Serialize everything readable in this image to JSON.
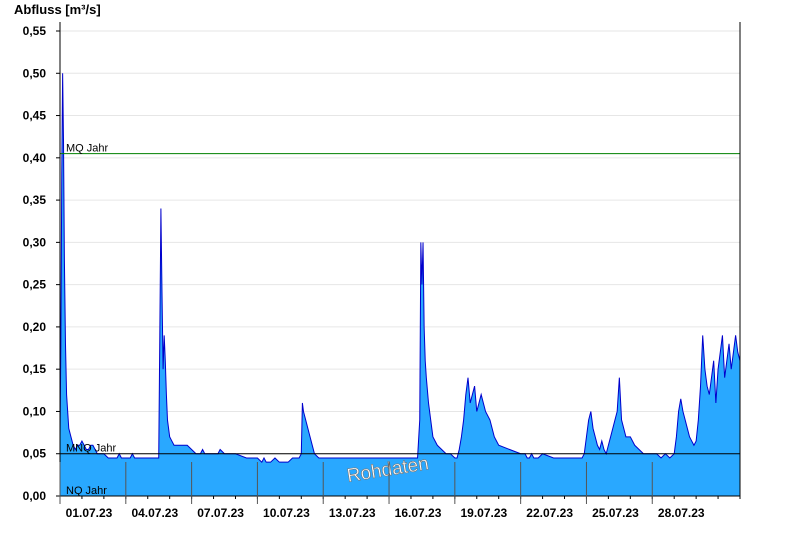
{
  "chart_data": {
    "type": "area",
    "title": "",
    "ylabel": "Abfluss [m³/s]",
    "xlabel": "",
    "xlim": [
      1,
      32
    ],
    "ylim": [
      0,
      0.56
    ],
    "yticks": [
      0,
      0.05,
      0.1,
      0.15,
      0.2,
      0.25,
      0.3,
      0.35,
      0.4,
      0.45,
      0.5,
      0.55
    ],
    "ytick_labels": [
      "0,00",
      "0,05",
      "0,10",
      "0,15",
      "0,20",
      "0,25",
      "0,30",
      "0,35",
      "0,40",
      "0,45",
      "0,50",
      "0,55"
    ],
    "xticks": [
      1,
      4,
      7,
      10,
      13,
      16,
      19,
      22,
      25,
      28
    ],
    "xtick_labels": [
      "01.07.23",
      "04.07.23",
      "07.07.23",
      "10.07.23",
      "13.07.23",
      "16.07.23",
      "19.07.23",
      "22.07.23",
      "25.07.23",
      "28.07.23"
    ],
    "grid": true,
    "colors": {
      "fill": "#29a8ff",
      "line": "#0000cc",
      "mq": "#008000",
      "ref": "#000000",
      "grid": "#e6e6e6"
    },
    "reference_lines": [
      {
        "label": "MQ Jahr",
        "value": 0.405
      },
      {
        "label": "MNQ Jahr",
        "value": 0.05
      },
      {
        "label": "NQ Jahr",
        "value": 0.0
      }
    ],
    "watermark": "Rohdaten",
    "series": [
      {
        "x": [
          1.0,
          1.04,
          1.08,
          1.12,
          1.16,
          1.2,
          1.25,
          1.3,
          1.35,
          1.4,
          1.5,
          1.6,
          1.7,
          1.8,
          1.9,
          2.0,
          2.1,
          2.2,
          2.3,
          2.4,
          2.5,
          2.6,
          2.7,
          2.8,
          2.9,
          3.0,
          3.2,
          3.4,
          3.6,
          3.7,
          3.8,
          4.0,
          4.2,
          4.3,
          4.4,
          4.5,
          4.6,
          4.7,
          4.8,
          5.0,
          5.2,
          5.5,
          5.55,
          5.6,
          5.65,
          5.7,
          5.75,
          5.8,
          5.85,
          5.9,
          6.0,
          6.1,
          6.2,
          6.3,
          6.5,
          6.8,
          7.0,
          7.2,
          7.4,
          7.5,
          7.6,
          7.8,
          8.0,
          8.2,
          8.3,
          8.5,
          8.8,
          9.0,
          9.5,
          10.0,
          10.2,
          10.3,
          10.4,
          10.6,
          10.8,
          11.0,
          11.2,
          11.4,
          11.6,
          11.9,
          12.0,
          12.05,
          12.1,
          12.2,
          12.3,
          12.4,
          12.5,
          12.6,
          12.8,
          13.0,
          13.5,
          14.0,
          14.5,
          15.0,
          15.5,
          16.0,
          16.5,
          17.0,
          17.3,
          17.4,
          17.45,
          17.5,
          17.55,
          17.6,
          17.65,
          17.7,
          17.8,
          17.9,
          18.0,
          18.2,
          18.4,
          18.6,
          18.8,
          19.0,
          19.1,
          19.2,
          19.3,
          19.4,
          19.5,
          19.6,
          19.7,
          19.8,
          19.9,
          20.0,
          20.1,
          20.2,
          20.3,
          20.4,
          20.6,
          20.8,
          21.0,
          21.5,
          22.0,
          22.2,
          22.3,
          22.4,
          22.5,
          22.6,
          22.8,
          23.0,
          23.5,
          24.0,
          24.4,
          24.6,
          24.7,
          24.8,
          24.9,
          25.0,
          25.1,
          25.2,
          25.3,
          25.4,
          25.5,
          25.6,
          25.7,
          25.8,
          25.9,
          26.0,
          26.1,
          26.2,
          26.3,
          26.4,
          26.5,
          26.6,
          26.7,
          26.8,
          27.0,
          27.2,
          27.4,
          27.6,
          27.8,
          28.0,
          28.2,
          28.4,
          28.6,
          28.8,
          29.0,
          29.1,
          29.2,
          29.3,
          29.4,
          29.5,
          29.6,
          29.7,
          29.8,
          29.9,
          30.0,
          30.1,
          30.2,
          30.3,
          30.4,
          30.5,
          30.6,
          30.7,
          30.8,
          30.9,
          31.0,
          31.1,
          31.2,
          31.3,
          31.4,
          31.5,
          31.6,
          31.7,
          31.8,
          31.9,
          32.0
        ],
        "y": [
          0.07,
          0.18,
          0.38,
          0.5,
          0.42,
          0.28,
          0.18,
          0.12,
          0.1,
          0.08,
          0.07,
          0.06,
          0.055,
          0.06,
          0.06,
          0.065,
          0.06,
          0.055,
          0.055,
          0.06,
          0.06,
          0.055,
          0.05,
          0.05,
          0.05,
          0.05,
          0.045,
          0.045,
          0.045,
          0.05,
          0.045,
          0.045,
          0.045,
          0.05,
          0.045,
          0.045,
          0.045,
          0.045,
          0.045,
          0.045,
          0.045,
          0.045,
          0.19,
          0.34,
          0.24,
          0.15,
          0.19,
          0.16,
          0.12,
          0.09,
          0.07,
          0.065,
          0.06,
          0.06,
          0.06,
          0.06,
          0.055,
          0.05,
          0.05,
          0.055,
          0.05,
          0.05,
          0.05,
          0.05,
          0.055,
          0.05,
          0.05,
          0.05,
          0.045,
          0.045,
          0.04,
          0.045,
          0.04,
          0.04,
          0.045,
          0.04,
          0.04,
          0.04,
          0.045,
          0.045,
          0.05,
          0.11,
          0.1,
          0.09,
          0.08,
          0.07,
          0.06,
          0.05,
          0.045,
          0.045,
          0.045,
          0.045,
          0.045,
          0.045,
          0.045,
          0.045,
          0.045,
          0.045,
          0.045,
          0.09,
          0.3,
          0.25,
          0.3,
          0.2,
          0.16,
          0.14,
          0.11,
          0.09,
          0.07,
          0.06,
          0.055,
          0.05,
          0.05,
          0.045,
          0.045,
          0.055,
          0.07,
          0.09,
          0.12,
          0.14,
          0.11,
          0.12,
          0.13,
          0.1,
          0.11,
          0.12,
          0.11,
          0.1,
          0.09,
          0.07,
          0.06,
          0.055,
          0.05,
          0.05,
          0.045,
          0.045,
          0.05,
          0.045,
          0.045,
          0.05,
          0.045,
          0.045,
          0.045,
          0.045,
          0.045,
          0.045,
          0.05,
          0.07,
          0.09,
          0.1,
          0.08,
          0.07,
          0.06,
          0.055,
          0.065,
          0.055,
          0.05,
          0.06,
          0.07,
          0.08,
          0.09,
          0.1,
          0.14,
          0.09,
          0.08,
          0.07,
          0.07,
          0.06,
          0.055,
          0.05,
          0.05,
          0.05,
          0.05,
          0.045,
          0.05,
          0.045,
          0.05,
          0.07,
          0.1,
          0.115,
          0.1,
          0.09,
          0.08,
          0.07,
          0.065,
          0.06,
          0.065,
          0.09,
          0.13,
          0.19,
          0.15,
          0.13,
          0.12,
          0.14,
          0.16,
          0.11,
          0.15,
          0.17,
          0.19,
          0.14,
          0.16,
          0.18,
          0.15,
          0.17,
          0.19,
          0.17,
          0.16
        ]
      }
    ]
  }
}
